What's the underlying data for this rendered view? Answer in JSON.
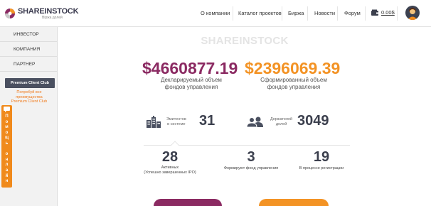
{
  "header": {
    "logo_text": "SHAREINSTOCK",
    "logo_sub": "Biржа долей",
    "nav": [
      "О компании",
      "Каталог проектов",
      "Биржа",
      "Новости",
      "Форум"
    ],
    "balance": "0.00$"
  },
  "sidebar": {
    "items": [
      "ИНВЕСТОР",
      "КОМПАНИЯ",
      "ПАРТНЕР"
    ],
    "club_button": "Premium Client Club",
    "club_note_1": "Попробуй все",
    "club_note_2": "преимущества",
    "club_note_3": "Premium Client Club",
    "help_letters": [
      "П",
      "о",
      "м",
      "о",
      "щ",
      "ь",
      " ",
      "о",
      "н",
      "л",
      "а",
      "й",
      "н"
    ]
  },
  "main": {
    "watermark": "SHAREINSTOCK",
    "declared_value": "$4660877.19",
    "declared_label_1": "Декларируемый объем",
    "declared_label_2": "фондов управления",
    "formed_value": "$2396069.39",
    "formed_label_1": "Сформированный объем",
    "formed_label_2": "фондов управления",
    "issuers_label_1": "Эмитентов",
    "issuers_label_2": "в системе",
    "issuers_value": "31",
    "holders_label_1": "Держателей",
    "holders_label_2": "долей",
    "holders_value": "3049",
    "active_value": "28",
    "active_label_1": "Активных",
    "active_label_2": "(Успешно завершенных IPO)",
    "forming_value": "3",
    "forming_label": "Формируют фонд управления",
    "registering_value": "19",
    "registering_label": "В процессе регистрации"
  },
  "colors": {
    "brand_purple": "#8b2a62",
    "brand_orange": "#f39325",
    "sidebar_button": "#4a5060",
    "help_orange": "#f08a1c",
    "dark_text": "#3b3f4d"
  }
}
